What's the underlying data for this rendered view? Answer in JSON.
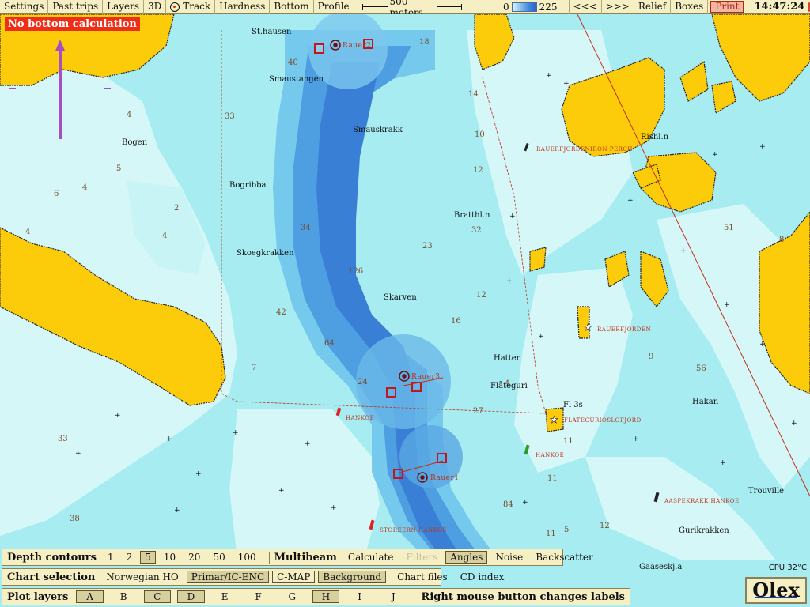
{
  "toolbar": {
    "settings": "Settings",
    "past_trips": "Past trips",
    "layers": "Layers",
    "view_3d": "3D",
    "track": "Track",
    "hardness": "Hardness",
    "bottom": "Bottom",
    "profile": "Profile",
    "scale": "500 meters",
    "depth_min": "0",
    "depth_max": "225",
    "back": "<<<",
    "forward": ">>>",
    "relief": "Relief",
    "boxes": "Boxes",
    "print": "Print",
    "clock": "14:47:24"
  },
  "warning": "No bottom calculation",
  "depth_contours": {
    "title": "Depth contours",
    "options": [
      "1",
      "2",
      "5",
      "10",
      "20",
      "50",
      "100"
    ],
    "active": "5"
  },
  "multibeam": {
    "title": "Multibeam",
    "calculate": "Calculate",
    "filters": "Filters",
    "angles": "Angles",
    "noise": "Noise",
    "backscatter": "Backscatter"
  },
  "chart_selection": {
    "title": "Chart selection",
    "norwegian_ho": "Norwegian HO",
    "primar": "Primar/IC-ENC",
    "cmap": "C-MAP",
    "background": "Background",
    "chart_files": "Chart files",
    "cd_index": "CD index"
  },
  "plot_layers": {
    "title": "Plot layers",
    "layers": [
      "A",
      "B",
      "C",
      "D",
      "E",
      "F",
      "G",
      "H",
      "I",
      "J"
    ],
    "active": [
      "A",
      "C",
      "D",
      "H"
    ],
    "hint": "Right mouse button changes labels"
  },
  "brand": "Olex",
  "cpu": "CPU 32°C",
  "map": {
    "places": [
      {
        "name": "St.hausen"
      },
      {
        "name": "Smaustangen"
      },
      {
        "name": "Smauskrakk"
      },
      {
        "name": "Bogen"
      },
      {
        "name": "Bogribba"
      },
      {
        "name": "Skoegkrakken"
      },
      {
        "name": "Skarven"
      },
      {
        "name": "Bratthl.n"
      },
      {
        "name": "Rishl.n"
      },
      {
        "name": "Hatten"
      },
      {
        "name": "Flåteguri"
      },
      {
        "name": "Hakan"
      },
      {
        "name": "Trouville"
      },
      {
        "name": "Gurikrakken"
      },
      {
        "name": "Gaaseskj.a"
      },
      {
        "name": "Fl 3s"
      }
    ],
    "red_labels": [
      {
        "name": "RAUERFJORDENIRON PERCH"
      },
      {
        "name": "RAUERFJORDEN"
      },
      {
        "name": "FLATEGURIOSLOFJORD"
      },
      {
        "name": "HANKOE"
      },
      {
        "name": "HANKOE"
      },
      {
        "name": "STOREERN HANKOE"
      },
      {
        "name": "AASPEKRAKK HANKOE"
      }
    ],
    "marks": [
      {
        "name": "Rauer2"
      },
      {
        "name": "Rauer3"
      },
      {
        "name": "Rauer1"
      }
    ]
  }
}
